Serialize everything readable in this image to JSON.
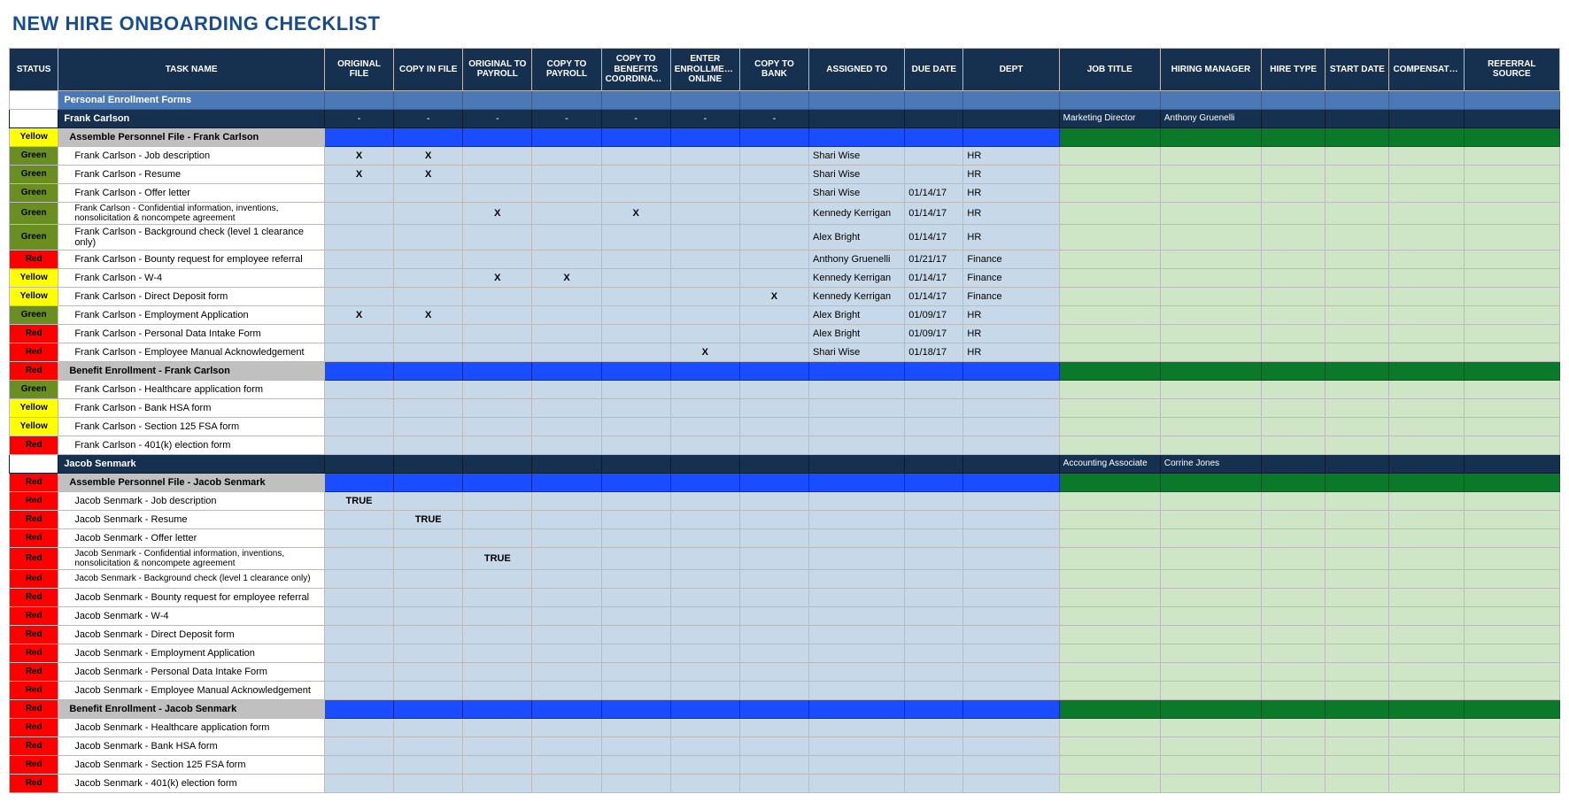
{
  "title": "NEW HIRE ONBOARDING CHECKLIST",
  "columns": [
    "STATUS",
    "TASK NAME",
    "ORIGINAL FILE",
    "COPY IN FILE",
    "ORIGINAL TO PAYROLL",
    "COPY TO PAYROLL",
    "COPY TO BENEFITS COORDINATOR",
    "ENTER ENROLLMENT ONLINE",
    "COPY TO BANK",
    "ASSIGNED TO",
    "DUE DATE",
    "DEPT",
    "JOB TITLE",
    "HIRING MANAGER",
    "HIRE TYPE",
    "START DATE",
    "COMPENSATION",
    "REFERRAL SOURCE"
  ],
  "statusColors": {
    "Green": "Green",
    "Yellow": "Yellow",
    "Red": "Red"
  },
  "rows": [
    {
      "type": "section",
      "task": "Personal Enrollment Forms"
    },
    {
      "type": "person",
      "task": "Frank Carlson",
      "marks": [
        "-",
        "-",
        "-",
        "-",
        "-",
        "-",
        "-"
      ],
      "job": "Marketing Director",
      "mgr": "Anthony Gruenelli"
    },
    {
      "type": "sub",
      "status": "Yellow",
      "task": "Assemble Personnel File - Frank Carlson"
    },
    {
      "type": "item",
      "status": "Green",
      "task": "Frank Carlson - Job description",
      "marks": [
        "X",
        "X",
        "",
        "",
        "",
        "",
        ""
      ],
      "assigned": "Shari Wise",
      "due": "",
      "dept": "HR"
    },
    {
      "type": "item",
      "status": "Green",
      "task": "Frank Carlson - Resume",
      "marks": [
        "X",
        "X",
        "",
        "",
        "",
        "",
        ""
      ],
      "assigned": "Shari Wise",
      "due": "",
      "dept": "HR"
    },
    {
      "type": "item",
      "status": "Green",
      "task": "Frank Carlson - Offer letter",
      "marks": [
        "",
        "",
        "",
        "",
        "",
        "",
        ""
      ],
      "assigned": "Shari Wise",
      "due": "01/14/17",
      "dept": "HR"
    },
    {
      "type": "item",
      "status": "Green",
      "task": "Frank Carlson - Confidential information, inventions, nonsolicitation & noncompete agreement",
      "marks": [
        "",
        "",
        "X",
        "",
        "X",
        "",
        ""
      ],
      "assigned": "Kennedy Kerrigan",
      "due": "01/14/17",
      "dept": "HR",
      "wrap": true
    },
    {
      "type": "item",
      "status": "Green",
      "task": "Frank Carlson - Background check (level 1 clearance only)",
      "marks": [
        "",
        "",
        "",
        "",
        "",
        "",
        ""
      ],
      "assigned": "Alex Bright",
      "due": "01/14/17",
      "dept": "HR"
    },
    {
      "type": "item",
      "status": "Red",
      "task": "Frank Carlson - Bounty request for employee referral",
      "marks": [
        "",
        "",
        "",
        "",
        "",
        "",
        ""
      ],
      "assigned": "Anthony Gruenelli",
      "due": "01/21/17",
      "dept": "Finance"
    },
    {
      "type": "item",
      "status": "Yellow",
      "task": "Frank Carlson - W-4",
      "marks": [
        "",
        "",
        "X",
        "X",
        "",
        "",
        ""
      ],
      "assigned": "Kennedy Kerrigan",
      "due": "01/14/17",
      "dept": "Finance"
    },
    {
      "type": "item",
      "status": "Yellow",
      "task": "Frank Carlson - Direct Deposit form",
      "marks": [
        "",
        "",
        "",
        "",
        "",
        "",
        "X"
      ],
      "assigned": "Kennedy Kerrigan",
      "due": "01/14/17",
      "dept": "Finance"
    },
    {
      "type": "item",
      "status": "Green",
      "task": "Frank Carlson - Employment Application",
      "marks": [
        "X",
        "X",
        "",
        "",
        "",
        "",
        ""
      ],
      "assigned": "Alex Bright",
      "due": "01/09/17",
      "dept": "HR"
    },
    {
      "type": "item",
      "status": "Red",
      "task": "Frank Carlson - Personal Data Intake Form",
      "marks": [
        "",
        "",
        "",
        "",
        "",
        "",
        ""
      ],
      "assigned": "Alex Bright",
      "due": "01/09/17",
      "dept": "HR"
    },
    {
      "type": "item",
      "status": "Red",
      "task": "Frank Carlson - Employee Manual Acknowledgement",
      "marks": [
        "",
        "",
        "",
        "",
        "",
        "X",
        ""
      ],
      "assigned": "Shari Wise",
      "due": "01/18/17",
      "dept": "HR"
    },
    {
      "type": "sub",
      "status": "Red",
      "task": "Benefit Enrollment - Frank Carlson"
    },
    {
      "type": "item",
      "status": "Green",
      "task": "Frank Carlson - Healthcare application form",
      "marks": [
        "",
        "",
        "",
        "",
        "",
        "",
        ""
      ],
      "assigned": "",
      "due": "",
      "dept": ""
    },
    {
      "type": "item",
      "status": "Yellow",
      "task": "Frank Carlson - Bank HSA form",
      "marks": [
        "",
        "",
        "",
        "",
        "",
        "",
        ""
      ],
      "assigned": "",
      "due": "",
      "dept": ""
    },
    {
      "type": "item",
      "status": "Yellow",
      "task": "Frank Carlson - Section 125 FSA form",
      "marks": [
        "",
        "",
        "",
        "",
        "",
        "",
        ""
      ],
      "assigned": "",
      "due": "",
      "dept": ""
    },
    {
      "type": "item",
      "status": "Red",
      "task": "Frank Carlson - 401(k) election form",
      "marks": [
        "",
        "",
        "",
        "",
        "",
        "",
        ""
      ],
      "assigned": "",
      "due": "",
      "dept": ""
    },
    {
      "type": "person",
      "task": "Jacob Senmark",
      "marks": [
        "",
        "",
        "",
        "",
        "",
        "",
        ""
      ],
      "job": "Accounting Associate",
      "mgr": "Corrine Jones"
    },
    {
      "type": "sub",
      "status": "Red",
      "task": "Assemble Personnel File - Jacob Senmark"
    },
    {
      "type": "item",
      "status": "Red",
      "task": "Jacob Senmark - Job description",
      "marks": [
        "TRUE",
        "",
        "",
        "",
        "",
        "",
        ""
      ],
      "assigned": "",
      "due": "",
      "dept": ""
    },
    {
      "type": "item",
      "status": "Red",
      "task": "Jacob Senmark - Resume",
      "marks": [
        "",
        "TRUE",
        "",
        "",
        "",
        "",
        ""
      ],
      "assigned": "",
      "due": "",
      "dept": ""
    },
    {
      "type": "item",
      "status": "Red",
      "task": "Jacob Senmark - Offer letter",
      "marks": [
        "",
        "",
        "",
        "",
        "",
        "",
        ""
      ],
      "assigned": "",
      "due": "",
      "dept": ""
    },
    {
      "type": "item",
      "status": "Red",
      "task": "Jacob Senmark - Confidential information, inventions, nonsolicitation & noncompete agreement",
      "marks": [
        "",
        "",
        "TRUE",
        "",
        "",
        "",
        ""
      ],
      "assigned": "",
      "due": "",
      "dept": "",
      "wrap": true
    },
    {
      "type": "item",
      "status": "Red",
      "task": "Jacob Senmark - Background check (level 1 clearance only)",
      "marks": [
        "",
        "",
        "",
        "",
        "",
        "",
        ""
      ],
      "assigned": "",
      "due": "",
      "dept": "",
      "wrap": true
    },
    {
      "type": "item",
      "status": "Red",
      "task": "Jacob Senmark - Bounty request for employee referral",
      "marks": [
        "",
        "",
        "",
        "",
        "",
        "",
        ""
      ],
      "assigned": "",
      "due": "",
      "dept": ""
    },
    {
      "type": "item",
      "status": "Red",
      "task": "Jacob Senmark - W-4",
      "marks": [
        "",
        "",
        "",
        "",
        "",
        "",
        ""
      ],
      "assigned": "",
      "due": "",
      "dept": ""
    },
    {
      "type": "item",
      "status": "Red",
      "task": "Jacob Senmark - Direct Deposit form",
      "marks": [
        "",
        "",
        "",
        "",
        "",
        "",
        ""
      ],
      "assigned": "",
      "due": "",
      "dept": ""
    },
    {
      "type": "item",
      "status": "Red",
      "task": "Jacob Senmark - Employment Application",
      "marks": [
        "",
        "",
        "",
        "",
        "",
        "",
        ""
      ],
      "assigned": "",
      "due": "",
      "dept": ""
    },
    {
      "type": "item",
      "status": "Red",
      "task": "Jacob Senmark - Personal Data Intake Form",
      "marks": [
        "",
        "",
        "",
        "",
        "",
        "",
        ""
      ],
      "assigned": "",
      "due": "",
      "dept": ""
    },
    {
      "type": "item",
      "status": "Red",
      "task": "Jacob Senmark - Employee Manual Acknowledgement",
      "marks": [
        "",
        "",
        "",
        "",
        "",
        "",
        ""
      ],
      "assigned": "",
      "due": "",
      "dept": ""
    },
    {
      "type": "sub",
      "status": "Red",
      "task": "Benefit Enrollment - Jacob Senmark"
    },
    {
      "type": "item",
      "status": "Red",
      "task": "Jacob Senmark - Healthcare application form",
      "marks": [
        "",
        "",
        "",
        "",
        "",
        "",
        ""
      ],
      "assigned": "",
      "due": "",
      "dept": ""
    },
    {
      "type": "item",
      "status": "Red",
      "task": "Jacob Senmark - Bank HSA form",
      "marks": [
        "",
        "",
        "",
        "",
        "",
        "",
        ""
      ],
      "assigned": "",
      "due": "",
      "dept": ""
    },
    {
      "type": "item",
      "status": "Red",
      "task": "Jacob Senmark - Section 125 FSA form",
      "marks": [
        "",
        "",
        "",
        "",
        "",
        "",
        ""
      ],
      "assigned": "",
      "due": "",
      "dept": ""
    },
    {
      "type": "item",
      "status": "Red",
      "task": "Jacob Senmark - 401(k) election form",
      "marks": [
        "",
        "",
        "",
        "",
        "",
        "",
        ""
      ],
      "assigned": "",
      "due": "",
      "dept": ""
    }
  ]
}
